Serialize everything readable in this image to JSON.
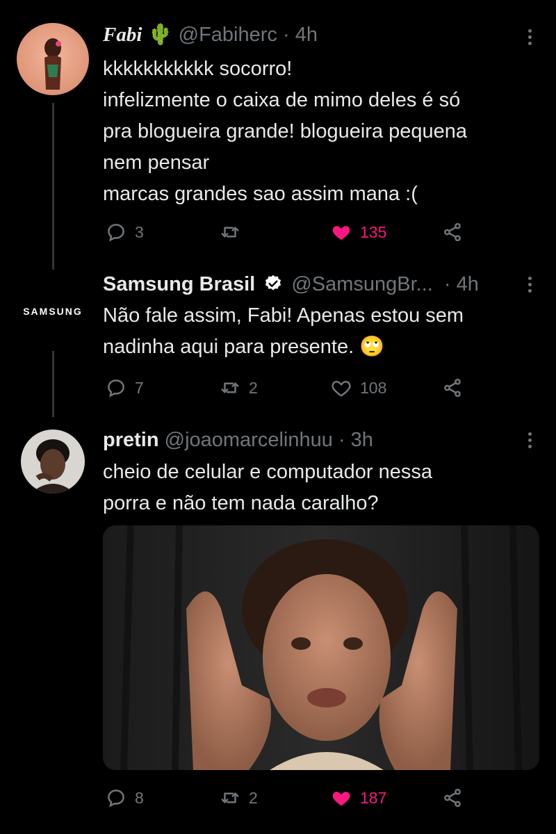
{
  "tweets": [
    {
      "display_name": "Fabi",
      "name_emoji": "🌵",
      "handle": "@Fabiherc",
      "time": "· 4h",
      "lines": [
        "kkkkkkkkkkk socorro!",
        "infelizmente o caixa de mimo deles é só",
        "pra blogueira grande! blogueira pequena",
        "nem pensar",
        "marcas grandes sao assim mana :("
      ],
      "replies": "3",
      "retweets": "",
      "likes": "135",
      "liked": true
    },
    {
      "display_name": "Samsung Brasil",
      "verified": true,
      "avatar_text": "SAMSUNG",
      "handle": "@SamsungBr...",
      "time": "· 4h",
      "lines": [
        "Não fale assim, Fabi! Apenas estou sem",
        "nadinha aqui para presente."
      ],
      "line_emoji": "🙄",
      "replies": "7",
      "retweets": "2",
      "likes": "108",
      "liked": false
    },
    {
      "display_name": "pretin",
      "handle": "@joaomarcelinhuu",
      "time": "· 3h",
      "lines": [
        "cheio de celular e computador nessa",
        "porra e não tem nada caralho?"
      ],
      "replies": "8",
      "retweets": "2",
      "likes": "187",
      "liked": true
    }
  ],
  "colors": {
    "background": "#000000",
    "text": "#e7e9ea",
    "secondary": "#71767b",
    "like": "#f91880",
    "thread_line": "#333639",
    "verified": "#ffffff"
  },
  "icons": [
    "reply-icon",
    "retweet-icon",
    "like-icon",
    "share-icon",
    "more-icon",
    "verified-icon"
  ]
}
